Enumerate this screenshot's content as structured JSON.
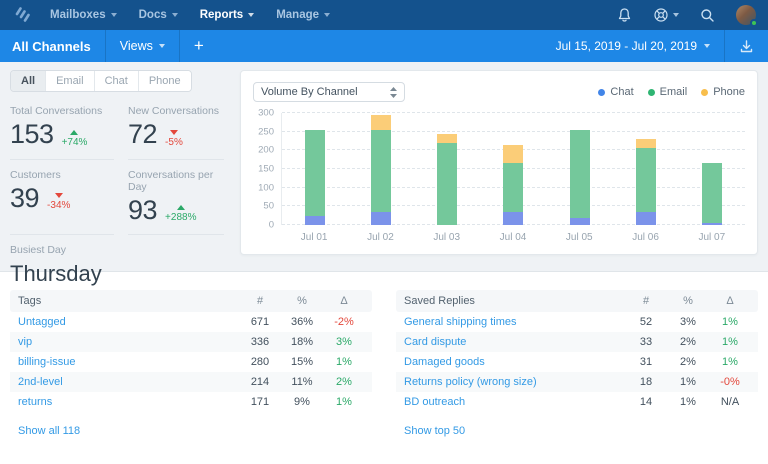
{
  "topnav": {
    "menu": [
      {
        "label": "Mailboxes",
        "active": false
      },
      {
        "label": "Docs",
        "active": false
      },
      {
        "label": "Reports",
        "active": true
      },
      {
        "label": "Manage",
        "active": false
      }
    ],
    "icons": [
      "notification-bell",
      "help-beacon",
      "search",
      "user-avatar"
    ],
    "avatar_status": "online"
  },
  "subnav": {
    "title": "All Channels",
    "views_label": "Views",
    "add_label": "+",
    "date_range": "Jul 15, 2019 - Jul 20, 2019",
    "export_icon": "download"
  },
  "filters": {
    "options": [
      "All",
      "Email",
      "Chat",
      "Phone"
    ],
    "selected": "All"
  },
  "metrics": [
    {
      "label": "Total Conversations",
      "value": "153",
      "delta": "+74%",
      "direction": "up"
    },
    {
      "label": "New Conversations",
      "value": "72",
      "delta": "-5%",
      "direction": "down"
    },
    {
      "label": "Customers",
      "value": "39",
      "delta": "-34%",
      "direction": "down"
    },
    {
      "label": "Conversations per Day",
      "value": "93",
      "delta": "+288%",
      "direction": "up"
    }
  ],
  "busiest_day": {
    "label": "Busiest Day",
    "value": "Thursday"
  },
  "chart_data": {
    "type": "bar",
    "stacked": true,
    "title": "Volume By Channel",
    "categories": [
      "Jul 01",
      "Jul 02",
      "Jul 03",
      "Jul 04",
      "Jul 05",
      "Jul 06",
      "Jul 07"
    ],
    "series": [
      {
        "name": "Chat",
        "color": "#7B93EA",
        "legend_color": "#4285E8",
        "values": [
          25,
          35,
          0,
          35,
          20,
          35,
          5
        ]
      },
      {
        "name": "Email",
        "color": "#74C89B",
        "legend_color": "#2FB573",
        "values": [
          230,
          220,
          220,
          130,
          235,
          170,
          160
        ]
      },
      {
        "name": "Phone",
        "color": "#FBCD78",
        "legend_color": "#F8BE4C",
        "values": [
          0,
          40,
          25,
          50,
          0,
          25,
          0
        ]
      }
    ],
    "ylim": [
      0,
      300
    ],
    "yticks": [
      0,
      50,
      100,
      150,
      200,
      250,
      300
    ],
    "legend_position": "top-right",
    "grid": "dashed-horizontal"
  },
  "tables": [
    {
      "title": "Tags",
      "columns": [
        "#",
        "%",
        "Δ"
      ],
      "rows": [
        {
          "name": "Untagged",
          "count": "671",
          "pct": "36%",
          "delta": "-2%",
          "trend": "down"
        },
        {
          "name": "vip",
          "count": "336",
          "pct": "18%",
          "delta": "3%",
          "trend": "up"
        },
        {
          "name": "billing-issue",
          "count": "280",
          "pct": "15%",
          "delta": "1%",
          "trend": "up"
        },
        {
          "name": "2nd-level",
          "count": "214",
          "pct": "11%",
          "delta": "2%",
          "trend": "up"
        },
        {
          "name": "returns",
          "count": "171",
          "pct": "9%",
          "delta": "1%",
          "trend": "up"
        }
      ],
      "footer_link": "Show all 118"
    },
    {
      "title": "Saved Replies",
      "columns": [
        "#",
        "%",
        "Δ"
      ],
      "rows": [
        {
          "name": "General shipping times",
          "count": "52",
          "pct": "3%",
          "delta": "1%",
          "trend": "up"
        },
        {
          "name": "Card dispute",
          "count": "33",
          "pct": "2%",
          "delta": "1%",
          "trend": "up"
        },
        {
          "name": "Damaged goods",
          "count": "31",
          "pct": "2%",
          "delta": "1%",
          "trend": "up"
        },
        {
          "name": "Returns policy (wrong size)",
          "count": "18",
          "pct": "1%",
          "delta": "-0%",
          "trend": "down"
        },
        {
          "name": "BD outreach",
          "count": "14",
          "pct": "1%",
          "delta": "N/A",
          "trend": "neutral"
        }
      ],
      "footer_link": "Show top 50"
    }
  ],
  "colors": {
    "topnav_bg": "#14528D",
    "subnav_bg": "#1E87E6",
    "positive": "#2BA968",
    "negative": "#E3483C",
    "link": "#339AE5",
    "bar_chat": "#7B93EA",
    "bar_email": "#74C89B",
    "bar_phone": "#FBCD78"
  }
}
